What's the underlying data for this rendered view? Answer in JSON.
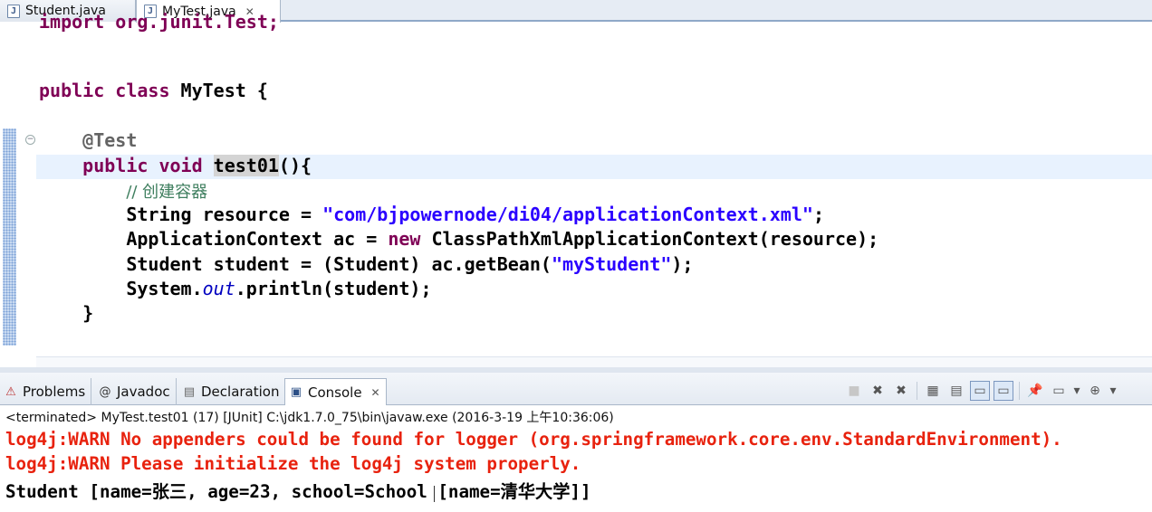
{
  "editor_tabs": [
    {
      "label": "Student.java",
      "icon": "java-file-icon"
    },
    {
      "label": "MyTest.java",
      "icon": "java-file-icon",
      "close": "✕"
    }
  ],
  "code": {
    "partial_top": "import org.junit.Test;",
    "class_kw": "public class ",
    "class_name": "MyTest {",
    "annotation": "@Test",
    "method_kw": "public void ",
    "method_name": "test01",
    "method_rest": "(){",
    "comment": "// 创建容器",
    "line_resource_a": "String resource = ",
    "line_resource_str": "\"com/bjpowernode/di04/applicationContext.xml\"",
    "line_resource_b": ";",
    "line_ac_a": "ApplicationContext ac = ",
    "line_ac_new": "new",
    "line_ac_b": " ClassPathXmlApplicationContext(resource);",
    "line_student_a": "Student student = (Student) ac.getBean(",
    "line_student_str": "\"myStudent\"",
    "line_student_b": ");",
    "line_print_a": "System.",
    "line_print_field": "out",
    "line_print_b": ".println(student);",
    "close_method": "}"
  },
  "view_tabs": [
    {
      "label": "Problems",
      "icon": "problems-icon"
    },
    {
      "label": "Javadoc",
      "icon": "at-icon"
    },
    {
      "label": "Declaration",
      "icon": "declaration-icon"
    },
    {
      "label": "Console",
      "icon": "console-icon",
      "close": "✕"
    }
  ],
  "console": {
    "terminated": "<terminated> MyTest.test01 (17) [JUnit] C:\\jdk1.7.0_75\\bin\\javaw.exe (2016-3-19 上午10:36:06)",
    "lines": [
      "log4j:WARN No appenders could be found for logger (org.springframework.core.env.StandardEnvironment).",
      "log4j:WARN Please initialize the log4j system properly.",
      "Student [name=张三, age=23, school=School [name=清华大学]]"
    ]
  },
  "colors": {
    "keyword": "#7f0055",
    "string": "#2a00ff",
    "comment": "#3f7f5f",
    "warn": "#e8220e"
  }
}
